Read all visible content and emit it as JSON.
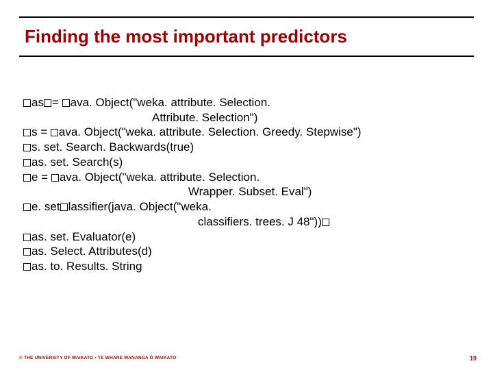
{
  "title": "Finding the most important predictors",
  "code": {
    "l1a": "as",
    "l1b": "= ",
    "l1c": "ava. Object(\"weka. attribute. Selection.",
    "l2": "                                        Attribute. Selection\")",
    "l3a": "s = ",
    "l3b": "ava. Object(\"weka. attribute. Selection. Greedy. Stepwise\")",
    "l4a": "s. ",
    "l4b": "set. Search. Backwards(true)",
    "l5a": "as",
    "l5b": ". set. Search(s)",
    "l6a": "e = ",
    "l6b": "ava. Object(\"weka. attribute. Selection.",
    "l7": "                                                   Wrapper. Subset. Eval\")",
    "l8a": "e. ",
    "l8b": "set",
    "l8c": "lassifier(java. Object(\"weka.",
    "l9": "                                                      classifiers. trees. J 48\"))",
    "l10a": "as",
    "l10b": ". set. Evaluator(e)",
    "l11a": "as",
    "l11b": ". Select. Attributes(d)",
    "l12a": "as",
    "l12b": ". to. Results. String"
  },
  "footer": "© THE UNIVERSITY OF WAIKATO  •  TE WHARE WANANGA O WAIKATO",
  "pagenum": "19"
}
